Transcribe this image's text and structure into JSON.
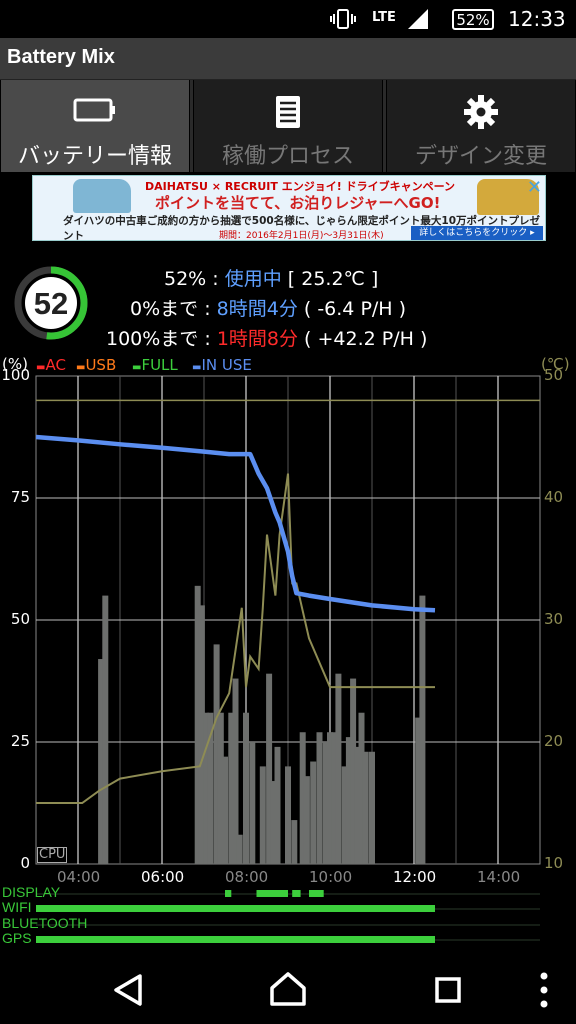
{
  "status_bar": {
    "network": "LTE",
    "battery_percent": "52%",
    "time": "12:33"
  },
  "app": {
    "title": "Battery Mix"
  },
  "tabs": [
    {
      "label": "バッテリー情報",
      "icon": "battery-icon",
      "active": true
    },
    {
      "label": "稼働プロセス",
      "icon": "list-icon",
      "active": false
    },
    {
      "label": "デザイン変更",
      "icon": "gear-icon",
      "active": false
    }
  ],
  "ad": {
    "line1": "DAIHATSU × RECRUIT エンジョイ! ドライブキャンペーン",
    "line2": "ポイントを当てて、お泊りレジャーへGO!",
    "line3": "ダイハツの中古車ご成約の方から抽選で500名様に、じゃらん限定ポイント最大10万ポイントプレゼント",
    "line4": "期間：2016年2月1日(月)〜3月31日(木)",
    "cta": "詳しくはこちらをクリック ▸",
    "close": "✕"
  },
  "battery": {
    "level": "52",
    "level_fraction": 0.52,
    "summary_percent": "52%",
    "summary_sep": " : ",
    "state": "使用中",
    "temperature": "[ 25.2℃ ]",
    "to_empty_label": "0%まで",
    "to_empty_time": "8時間4分",
    "to_empty_rate": "( -6.4 P/H )",
    "to_full_label": "100%まで",
    "to_full_time": "1時間8分",
    "to_full_rate": "( +42.2 P/H )"
  },
  "legend": {
    "left_unit": "(%)",
    "right_unit": "(℃)",
    "items": [
      {
        "label": "AC",
        "color": "#ff2a2a"
      },
      {
        "label": "USB",
        "color": "#ff7a1a"
      },
      {
        "label": "FULL",
        "color": "#3ccf3c"
      },
      {
        "label": "IN USE",
        "color": "#5b8ef0"
      }
    ]
  },
  "chart_data": {
    "type": "line",
    "x_ticks": [
      "04:00",
      "06:00",
      "08:00",
      "10:00",
      "12:00",
      "14:00"
    ],
    "x_tick_colors": [
      "#888888",
      "#ffffff",
      "#888888",
      "#888888",
      "#ffffff",
      "#888888"
    ],
    "xlim_hours": [
      3,
      15
    ],
    "y_left_ticks": [
      "100",
      "75",
      "50",
      "25",
      "0"
    ],
    "y_right_ticks": [
      "50",
      "40",
      "30",
      "20",
      "10"
    ],
    "ylim_left": [
      0,
      100
    ],
    "ylim_right": [
      10,
      50
    ],
    "cpu_label": "CPU",
    "grid": true,
    "series": [
      {
        "name": "IN USE",
        "color": "#5b8ef0",
        "axis": "left",
        "x": [
          3.0,
          4.0,
          5.0,
          6.0,
          7.0,
          7.6,
          7.8,
          8.1,
          8.3,
          8.5,
          8.7,
          8.8,
          9.0,
          9.1,
          9.2,
          9.5,
          10.0,
          11.0,
          12.0,
          12.5
        ],
        "y": [
          87.5,
          86.8,
          86.0,
          85.3,
          84.5,
          84.0,
          84.0,
          84.0,
          80,
          77,
          72,
          70,
          64,
          59,
          55.5,
          55,
          54.3,
          53,
          52.2,
          52
        ]
      },
      {
        "name": "Temperature",
        "color": "#8e8c54",
        "axis": "right",
        "x": [
          3.0,
          4.1,
          4.5,
          5.0,
          6.0,
          6.9,
          7.0,
          7.3,
          7.6,
          7.9,
          8.0,
          8.1,
          8.3,
          8.4,
          8.5,
          8.7,
          8.8,
          9.0,
          9.1,
          9.2,
          9.5,
          10.0,
          11.0,
          12.0,
          12.5
        ],
        "y": [
          15,
          15,
          16,
          17,
          17.6,
          18,
          19,
          22,
          24,
          31,
          24.5,
          27,
          26,
          31,
          37,
          32,
          37,
          42,
          33,
          33,
          28.5,
          24.5,
          24.5,
          24.5,
          24.5
        ]
      },
      {
        "name": "CPU",
        "color": "#6d6f6d",
        "axis": "left",
        "type": "bar",
        "x": [
          4.55,
          4.65,
          6.85,
          6.95,
          7.05,
          7.15,
          7.3,
          7.4,
          7.5,
          7.65,
          7.75,
          7.85,
          8.0,
          8.15,
          8.4,
          8.55,
          8.65,
          8.75,
          9.0,
          9.15,
          9.35,
          9.45,
          9.6,
          9.75,
          9.9,
          10.0,
          10.1,
          10.2,
          10.35,
          10.45,
          10.55,
          10.65,
          10.75,
          10.85,
          11.0,
          12.1,
          12.2
        ],
        "values": [
          42,
          55,
          57,
          53,
          31,
          31,
          45,
          31,
          22,
          31,
          38,
          6,
          31,
          25,
          20,
          39,
          17,
          24,
          20,
          9,
          27,
          18,
          21,
          27,
          25,
          27,
          27,
          39,
          20,
          26,
          38,
          24,
          31,
          23,
          23,
          30,
          55
        ]
      }
    ]
  },
  "indicators": [
    {
      "label": "DISPLAY",
      "segments": [
        [
          7.5,
          7.65
        ],
        [
          8.25,
          9.0
        ],
        [
          9.1,
          9.3
        ],
        [
          9.5,
          9.85
        ]
      ]
    },
    {
      "label": "WIFI",
      "segments": [
        [
          3.0,
          12.5
        ]
      ]
    },
    {
      "label": "BLUETOOTH",
      "segments": []
    },
    {
      "label": "GPS",
      "segments": [
        [
          3.0,
          12.5
        ]
      ]
    }
  ],
  "navbar": {
    "back": "back-icon",
    "home": "home-icon",
    "recents": "recents-icon",
    "menu": "overflow-menu-icon"
  }
}
